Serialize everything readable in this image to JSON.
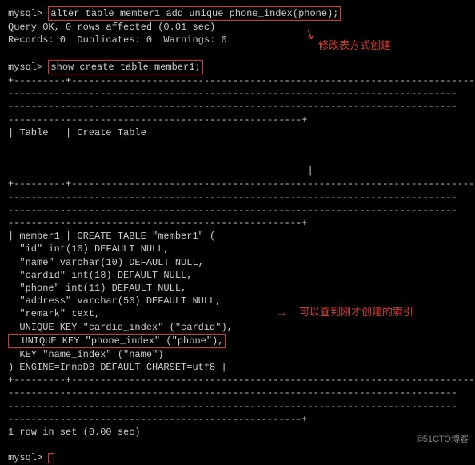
{
  "prompt": "mysql>",
  "cmd1": "alter table member1 add unique phone_index(phone);",
  "resp1_line1": "Query OK, 0 rows affected (0.01 sec)",
  "resp1_line2": "Records: 0  Duplicates: 0  Warnings: 0",
  "cmd2": "show create table member1;",
  "sep_full": "+---------+------------------------------------------------------------------------",
  "sep_blank": "",
  "sep_end": "---------------------------------------------------+",
  "header": "| Table   | Create Table",
  "header_end": "                                                    |",
  "create": {
    "l1": "| member1 | CREATE TABLE \"member1\" (",
    "l2": "  \"id\" int(10) DEFAULT NULL,",
    "l3": "  \"name\" varchar(10) DEFAULT NULL,",
    "l4": "  \"cardid\" int(18) DEFAULT NULL,",
    "l5": "  \"phone\" int(11) DEFAULT NULL,",
    "l6": "  \"address\" varchar(50) DEFAULT NULL,",
    "l7": "  \"remark\" text,",
    "l8": "  UNIQUE KEY \"cardid_index\" (\"cardid\"),",
    "l9": "  UNIQUE KEY \"phone_index\" (\"phone\"),",
    "l10": "  KEY \"name_index\" (\"name\")",
    "l11": ") ENGINE=InnoDB DEFAULT CHARSET=utf8 |"
  },
  "rowcount": "1 row in set (0.00 sec)",
  "annotations": {
    "a1": "修改表方式创建",
    "a2": "可以查到刚才创建的索引"
  },
  "watermark": "©51CTO博客"
}
